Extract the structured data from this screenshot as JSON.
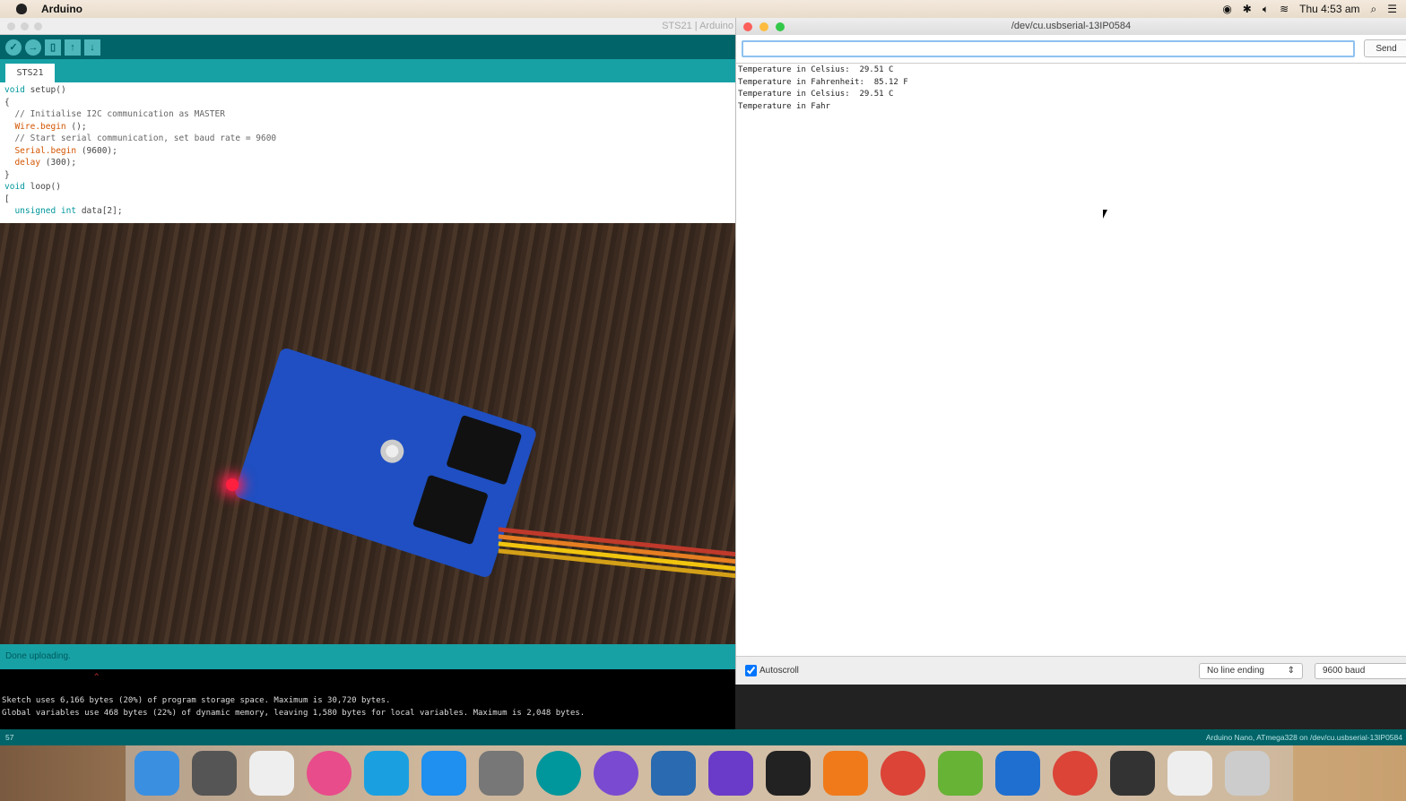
{
  "menubar": {
    "app": "Arduino",
    "clock": "Thu 4:53 am"
  },
  "ide": {
    "window_title": "STS21 | Arduino",
    "tab": "STS21",
    "code": [
      [
        [
          "kw",
          "void"
        ],
        [
          "",
          "setup()"
        ]
      ],
      [
        [
          "",
          "{"
        ]
      ],
      [
        [
          "cm",
          "  // Initialise I2C communication as MASTER"
        ]
      ],
      [
        [
          "fn",
          "  Wire.begin"
        ],
        [
          "",
          "();"
        ]
      ],
      [
        [
          "cm",
          "  // Start serial communication, set baud rate = 9600"
        ]
      ],
      [
        [
          "fn",
          "  Serial.begin"
        ],
        [
          "",
          "(9600);"
        ]
      ],
      [
        [
          "fn",
          "  delay"
        ],
        [
          "",
          "(300);"
        ]
      ],
      [
        [
          "",
          "}"
        ]
      ],
      [
        [
          "",
          ""
        ]
      ],
      [
        [
          "kw",
          "void"
        ],
        [
          "",
          "loop()"
        ]
      ],
      [
        [
          "",
          "["
        ]
      ],
      [
        [
          "kw",
          "  unsigned int"
        ],
        [
          "",
          "data[2];"
        ]
      ]
    ],
    "status": "Done uploading.",
    "console": [
      "Sketch uses 6,166 bytes (20%) of program storage space. Maximum is 30,720 bytes.",
      "Global variables use 468 bytes (22%) of dynamic memory, leaving 1,580 bytes for local variables. Maximum is 2,048 bytes."
    ],
    "line_number": "57",
    "board": "Arduino Nano, ATmega328 on /dev/cu.usbserial-13IP0584"
  },
  "serial": {
    "title": "/dev/cu.usbserial-13IP0584",
    "send": "Send",
    "input_value": "",
    "output": [
      "Temperature in Celsius:  29.51 C",
      "Temperature in Fahrenheit:  85.12 F",
      "Temperature in Celsius:  29.51 C",
      "Temperature in Fahr"
    ],
    "autoscroll": "Autoscroll",
    "line_ending": "No line ending",
    "baud": "9600 baud"
  },
  "dock": [
    "finder",
    "launchpad",
    "textedit",
    "itunes",
    "skype",
    "app-store",
    "system-preferences",
    "arduino",
    "github",
    "quicktime",
    "imovie",
    "terminal",
    "vlc",
    "chrome",
    "utorrent",
    "teamviewer",
    "chrome",
    "keyboard-viewer",
    "preview",
    "trash"
  ]
}
